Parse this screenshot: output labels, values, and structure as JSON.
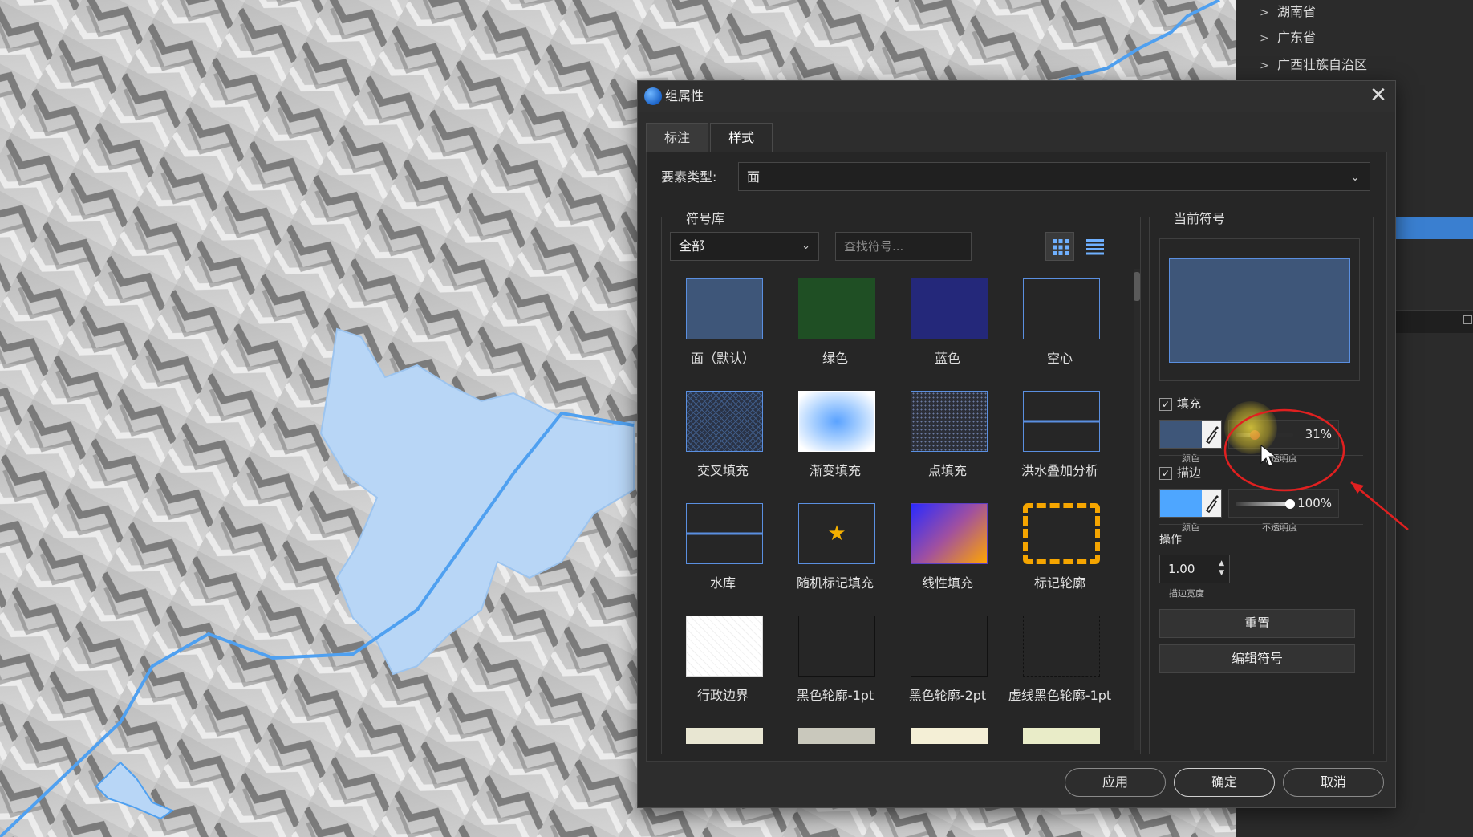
{
  "map": {
    "description_icon": "terrain-hillshade-icon"
  },
  "right_panel": {
    "tree_items": [
      {
        "label": "湖南省"
      },
      {
        "label": "广东省"
      },
      {
        "label": "广西壮族自治区"
      }
    ],
    "chevron_icon": "chevron-right-icon"
  },
  "dialog": {
    "title": "组属性",
    "close_icon": "close-icon",
    "tabs": [
      {
        "label": "标注",
        "active": false
      },
      {
        "label": "样式",
        "active": true
      }
    ],
    "feature_type": {
      "label": "要素类型:",
      "value": "面"
    },
    "symbol_library": {
      "caption": "符号库",
      "category": "全部",
      "search_placeholder": "查找符号...",
      "items": [
        {
          "label": "面（默认）",
          "color": "#3e5679",
          "border": "#5a8fe0"
        },
        {
          "label": "绿色",
          "color": "#1f4f24",
          "border": "#1f4f24"
        },
        {
          "label": "蓝色",
          "color": "#24287a",
          "border": "#24287a"
        },
        {
          "label": "空心",
          "color": "#262626",
          "border": "#5a8fe0"
        },
        {
          "label": "交叉填充",
          "color": "#2a3346",
          "border": "#5a8fe0"
        },
        {
          "label": "渐变填充",
          "color": "#7ab4ff",
          "border": "#ffffff"
        },
        {
          "label": "点填充",
          "color": "#2c2f38",
          "border": "#5a8fe0"
        },
        {
          "label": "洪水叠加分析",
          "color": "#262626",
          "border": "#5a8fe0"
        },
        {
          "label": "水库",
          "color": "#262626",
          "border": "#5a8fe0"
        },
        {
          "label": "随机标记填充",
          "color": "#262626",
          "border": "#5a8fe0"
        },
        {
          "label": "线性填充",
          "color": "#5a3fc0",
          "border": "#5a3fc0"
        },
        {
          "label": "标记轮廓",
          "color": "#262626",
          "border": "#f5a500"
        },
        {
          "label": "行政边界",
          "color": "#ffffff",
          "border": "#dddddd"
        },
        {
          "label": "黑色轮廓-1pt",
          "color": "#262626",
          "border": "#111111"
        },
        {
          "label": "黑色轮廓-2pt",
          "color": "#262626",
          "border": "#111111"
        },
        {
          "label": "虚线黑色轮廓-1pt",
          "color": "#262626",
          "border": "#111111"
        },
        {
          "label": "",
          "color": "#e8e6d2",
          "border": "#e8e6d2"
        },
        {
          "label": "",
          "color": "#c9c8bc",
          "border": "#c9c8bc"
        },
        {
          "label": "",
          "color": "#f4efd6",
          "border": "#f4efd6"
        },
        {
          "label": "",
          "color": "#e9ecc8",
          "border": "#e9ecc8"
        }
      ]
    },
    "current_symbol": {
      "caption": "当前符号",
      "fill": {
        "label": "填充",
        "checked": true,
        "color": "#3e5679",
        "color_label": "颜色",
        "opacity_label": "不透明度",
        "opacity": "31%"
      },
      "stroke": {
        "label": "描边",
        "checked": true,
        "color": "#4ea6ff",
        "color_label": "颜色",
        "opacity_label": "不透明度",
        "opacity": "100%"
      },
      "operation": {
        "label": "操作",
        "stroke_width": "1.00",
        "stroke_width_label": "描边宽度"
      },
      "reset_label": "重置",
      "edit_label": "编辑符号"
    },
    "footer": {
      "apply": "应用",
      "ok": "确定",
      "cancel": "取消"
    }
  }
}
